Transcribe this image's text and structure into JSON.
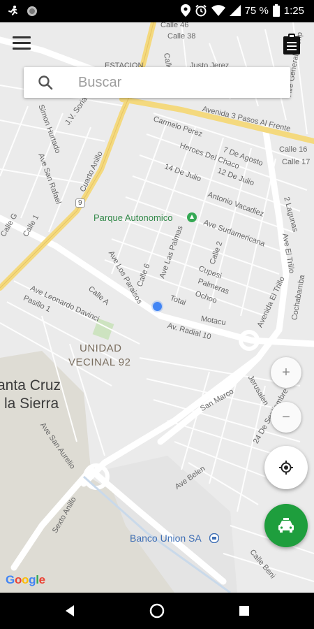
{
  "status_bar": {
    "battery_percent": "75 %",
    "time": "1:25",
    "icons": [
      "runner-icon",
      "circle-notification-icon",
      "location-icon",
      "alarm-icon",
      "wifi-icon",
      "signal-icon",
      "battery-icon"
    ]
  },
  "search": {
    "placeholder": "Buscar"
  },
  "map": {
    "street_labels": [
      "Calle 46",
      "Calle 38",
      "Calle 14",
      "Justo Jerez",
      "ESTACION",
      "Avenida 3 Pasos Al Frente",
      "Carmelo Perez",
      "Heroes Del Chaco",
      "7 De Agosto",
      "14 De Julio",
      "12 De Julio",
      "Antonio Vacadiez",
      "Ave Sudamericana",
      "Calle 16",
      "Calle 17",
      "2 Lagunas",
      "Ave El Trillo",
      "Calle G",
      "Calle 1",
      "Ave San Rafael",
      "Ave Las Palmas",
      "Ave Los Paraisos",
      "Calle 6",
      "Cupesi",
      "Palmeras",
      "Ochoo",
      "Calle 2",
      "Ave Leonardo Davinci",
      "Pasillo 1",
      "Calle A",
      "Totai",
      "Motacu",
      "Av. Radial 10",
      "Avenida El Trillo",
      "Cochabamba",
      "San Marco",
      "Jerusalen",
      "Ave Belen",
      "Ave San Aurelio",
      "Sexto Anillo",
      "Calle Beni",
      "Cuarto Anillo",
      "Simon Hurtado",
      "J.V. Soria",
      "24 De Septiembre",
      "Ave General Camp"
    ],
    "route_shield": "9",
    "park_label": "Parque Autonomico",
    "neighborhood": [
      "UNIDAD",
      "VECINAL 92"
    ],
    "city": [
      "anta Cruz",
      "la Sierra"
    ],
    "poi_label": "Banco Union SA",
    "logo": "Google"
  },
  "controls": {
    "zoom_in": "+",
    "zoom_out": "−"
  }
}
